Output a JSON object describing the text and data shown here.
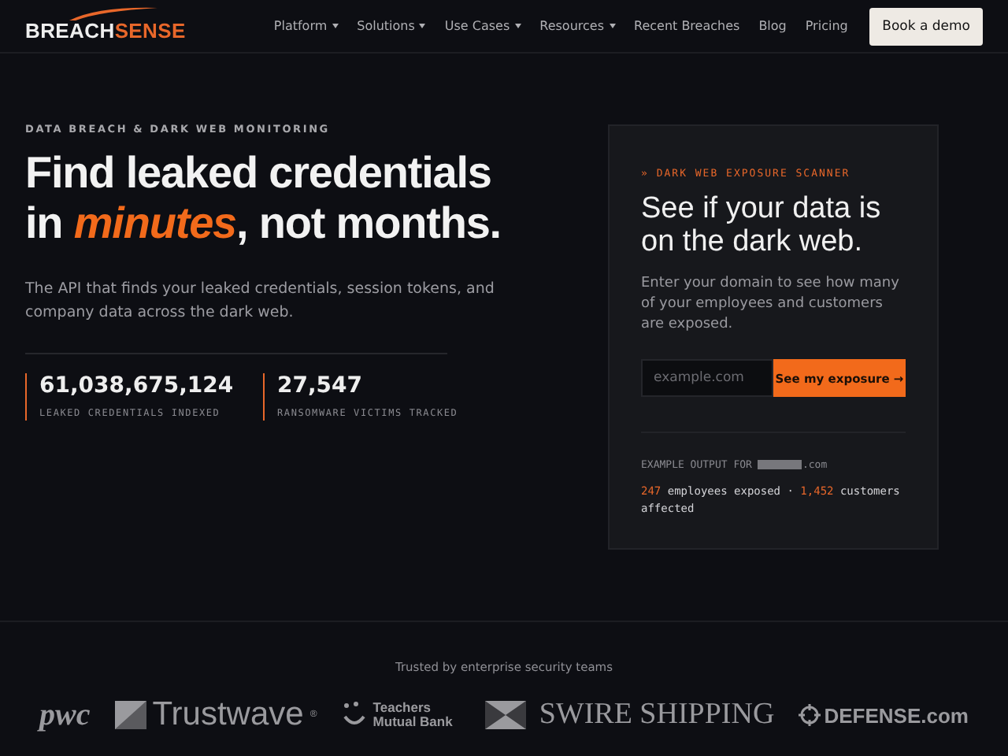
{
  "brand": {
    "first": "BREACH",
    "second": "SENSE"
  },
  "nav": [
    {
      "label": "Platform",
      "has_menu": true
    },
    {
      "label": "Solutions",
      "has_menu": true
    },
    {
      "label": "Use Cases",
      "has_menu": true
    },
    {
      "label": "Resources",
      "has_menu": true
    },
    {
      "label": "Recent Breaches",
      "has_menu": false
    },
    {
      "label": "Blog",
      "has_menu": false
    },
    {
      "label": "Pricing",
      "has_menu": false
    }
  ],
  "cta": "Book a demo",
  "hero": {
    "eyebrow": "DATA BREACH & DARK WEB MONITORING",
    "headline_1": "Find leaked credentials",
    "headline_2": "in *minutes*, not months.",
    "lead": "The API that finds your leaked credentials, session tokens, and company data across the dark web.",
    "stats": [
      {
        "value": "61,038,675,124",
        "label": "LEAKED CREDENTIALS INDEXED"
      },
      {
        "value": "27,547",
        "label": "RANSOMWARE VICTIMS TRACKED"
      }
    ]
  },
  "scanner": {
    "eyebrow": "» DARK WEB EXPOSURE SCANNER",
    "title": "See if your data is on the dark web.",
    "text": "Enter your domain to see how many of your employees and customers are exposed.",
    "placeholder": "example.com",
    "button": "See my exposure →",
    "example_label": "EXAMPLE OUTPUT FOR",
    "example_suffix": ".com",
    "example_result": "**247** employees exposed · **1,452** customers affected"
  },
  "trust": {
    "caption": "Trusted by enterprise security teams",
    "logos": [
      {
        "kind": "pwc",
        "text": "pwc"
      },
      {
        "kind": "trustwave",
        "text": "Trustwave",
        "mark": "®"
      },
      {
        "kind": "teachers",
        "text": "Teachers Mutual Bank"
      },
      {
        "kind": "swire",
        "text": "SWIRE SHIPPING"
      },
      {
        "kind": "defense",
        "text": "DEFENSE.com"
      }
    ]
  }
}
